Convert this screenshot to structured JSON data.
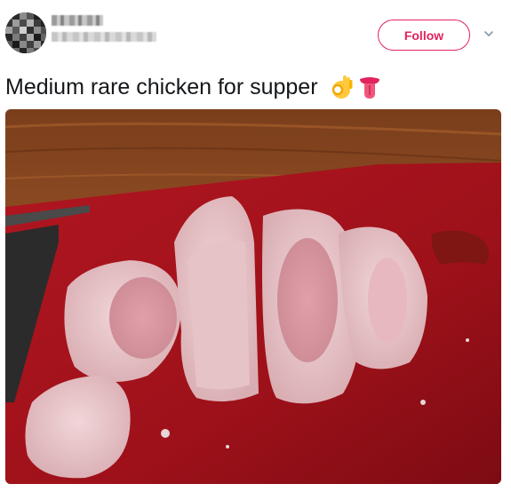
{
  "tweet": {
    "text": "Medium rare chicken for supper",
    "follow_label": "Follow",
    "emojis": [
      "ok-hand-icon",
      "tongue-face-icon"
    ],
    "colors": {
      "follow_accent": "#e0245e",
      "text": "#14171a"
    }
  },
  "header": {
    "avatar": "avatar-pixelated",
    "name_censored": true,
    "handle_censored": true,
    "menu_icon": "chevron-down-icon"
  },
  "media": {
    "type": "photo",
    "subject": "sliced chicken on red cutting board"
  }
}
